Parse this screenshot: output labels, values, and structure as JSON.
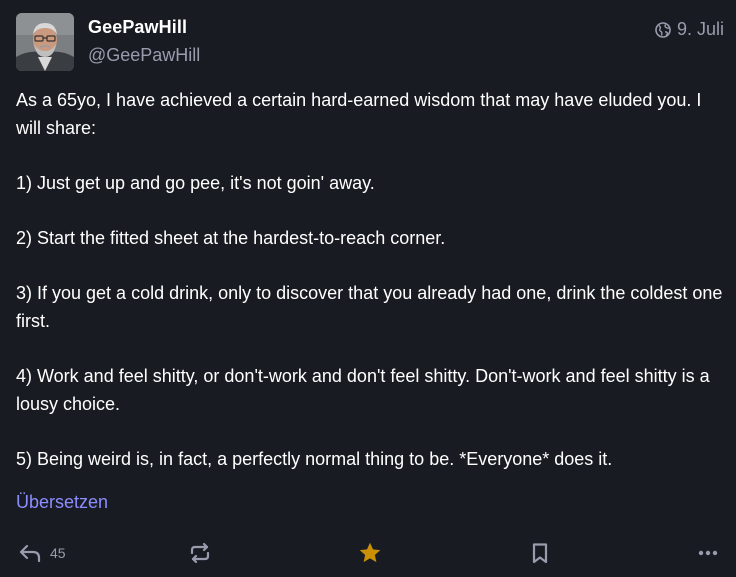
{
  "author": {
    "display_name": "GeePawHill",
    "handle": "@GeePawHill",
    "avatar_alt": "avatar"
  },
  "meta": {
    "visibility_icon": "globe-icon",
    "date": "9. Juli"
  },
  "post": {
    "paragraphs": [
      "As a 65yo, I have achieved a certain hard-earned wisdom that may have eluded you. I will share:",
      "1) Just get up and go pee, it's not goin' away.",
      "2) Start the fitted sheet at the hardest-to-reach corner.",
      "3) If you get a cold drink, only to discover that you already had one, drink the coldest one first.",
      "4) Work and feel shitty, or don't-work and don't feel shitty. Don't-work and feel shitty is a lousy choice.",
      "5) Being weird is, in fact, a perfectly normal thing to be. *Everyone* does it."
    ],
    "translate_label": "Übersetzen"
  },
  "actions": {
    "reply_count": "45",
    "reply_icon": "reply-icon",
    "boost_icon": "boost-icon",
    "favourite_icon": "star-icon",
    "bookmark_icon": "bookmark-icon",
    "more_icon": "more-icon"
  },
  "colors": {
    "background": "#191b22",
    "text": "#ffffff",
    "muted": "#9a9cae",
    "link": "#8c8dff",
    "favourite_active": "#ca8f04"
  }
}
